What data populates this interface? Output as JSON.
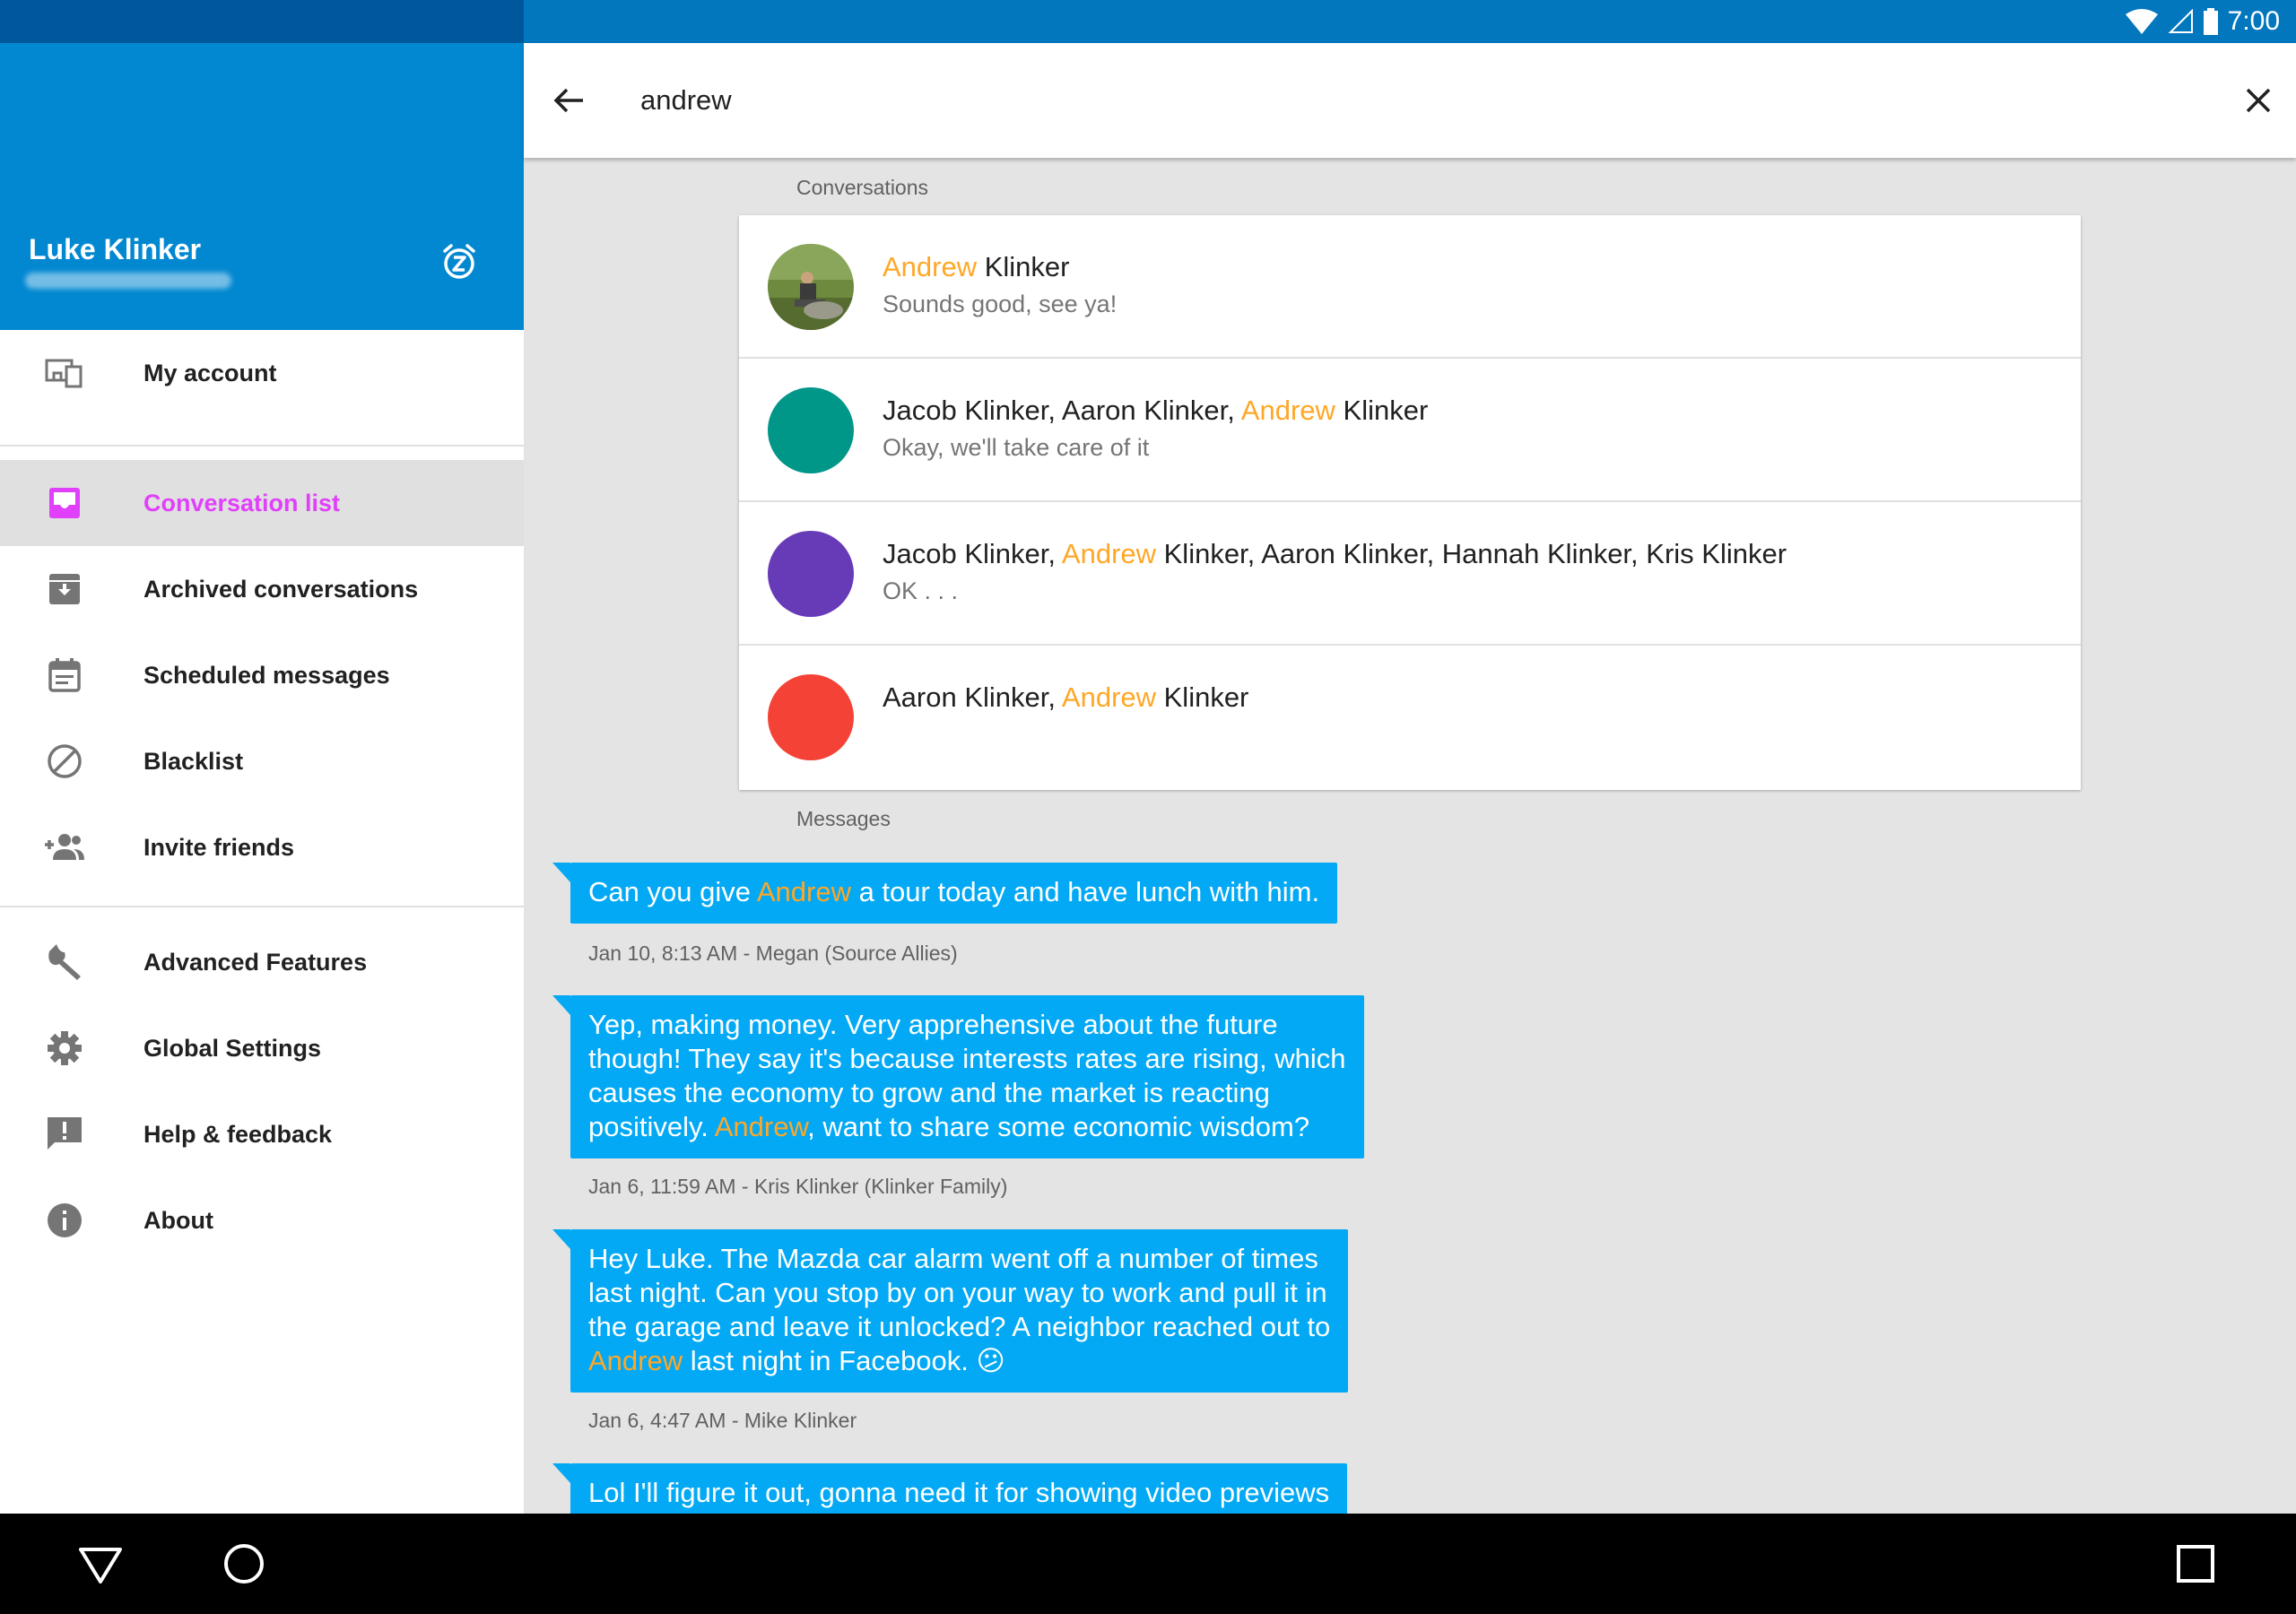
{
  "status_bar": {
    "time": "7:00",
    "icons": [
      "wifi-icon",
      "signal-icon",
      "battery-icon"
    ]
  },
  "drawer": {
    "user_name": "Luke Klinker",
    "snooze_icon": "snooze-alarm-icon",
    "items": [
      {
        "label": "My account",
        "icon": "devices-icon"
      },
      {
        "label": "Conversation list",
        "icon": "inbox-icon",
        "active": true
      },
      {
        "label": "Archived conversations",
        "icon": "archive-icon"
      },
      {
        "label": "Scheduled messages",
        "icon": "calendar-icon"
      },
      {
        "label": "Blacklist",
        "icon": "block-icon"
      },
      {
        "label": "Invite friends",
        "icon": "group-add-icon"
      },
      {
        "label": "Advanced Features",
        "icon": "wrench-icon"
      },
      {
        "label": "Global Settings",
        "icon": "gear-icon"
      },
      {
        "label": "Help & feedback",
        "icon": "feedback-icon"
      },
      {
        "label": "About",
        "icon": "info-icon"
      }
    ]
  },
  "search": {
    "query": "andrew",
    "highlight": "Andrew"
  },
  "sections": {
    "conversations": "Conversations",
    "messages": "Messages"
  },
  "conversations": [
    {
      "title_parts": [
        "",
        "Andrew",
        " Klinker"
      ],
      "snippet": "Sounds good, see ya!",
      "avatar": "photo",
      "color": "#7a8a3a"
    },
    {
      "title_parts": [
        "Jacob Klinker, Aaron Klinker, ",
        "Andrew",
        " Klinker"
      ],
      "snippet": "Okay, we'll take care of it",
      "avatar": "color",
      "color": "#009688"
    },
    {
      "title_parts": [
        "Jacob Klinker, ",
        "Andrew",
        " Klinker, Aaron Klinker, Hannah Klinker, Kris Klinker"
      ],
      "snippet": "OK . . .",
      "avatar": "color",
      "color": "#673ab7"
    },
    {
      "title_parts": [
        "Aaron Klinker, ",
        "Andrew",
        " Klinker"
      ],
      "snippet": "",
      "avatar": "color",
      "color": "#f44336"
    }
  ],
  "messages": [
    {
      "lines": [
        [
          "Can you give ",
          "Andrew",
          " a tour today and have lunch with him."
        ]
      ],
      "meta": "Jan 10, 8:13 AM - Megan (Source Allies)"
    },
    {
      "lines": [
        [
          "Yep, making money.  Very apprehensive about the future"
        ],
        [
          "though! They say it's because interests rates are rising, which"
        ],
        [
          "causes the economy to grow and the market is reacting"
        ],
        [
          "positively.  ",
          "Andrew",
          ", want to share some economic wisdom?"
        ]
      ],
      "meta": "Jan 6, 11:59 AM - Kris Klinker (Klinker Family)"
    },
    {
      "lines": [
        [
          "Hey Luke. The Mazda car alarm went off a number of times"
        ],
        [
          "last night. Can you stop by on your way to work and pull it in"
        ],
        [
          "the garage and leave it unlocked? A neighbor reached out to"
        ],
        [
          "",
          "Andrew",
          " last night in Facebook. 😕"
        ]
      ],
      "meta": "Jan 6, 4:47 AM - Mike Klinker"
    },
    {
      "lines": [
        [
          "Lol I'll figure it out, gonna need it for showing video previews"
        ]
      ],
      "meta": ""
    }
  ],
  "colors": {
    "primary": "#0288d1",
    "primary_dark": "#01579b",
    "accent": "#e040fb",
    "bubble": "#03a9f4",
    "highlight": "#ffa726"
  },
  "nav_bar": {
    "buttons": [
      "back-icon",
      "home-icon",
      "recents-icon"
    ]
  }
}
